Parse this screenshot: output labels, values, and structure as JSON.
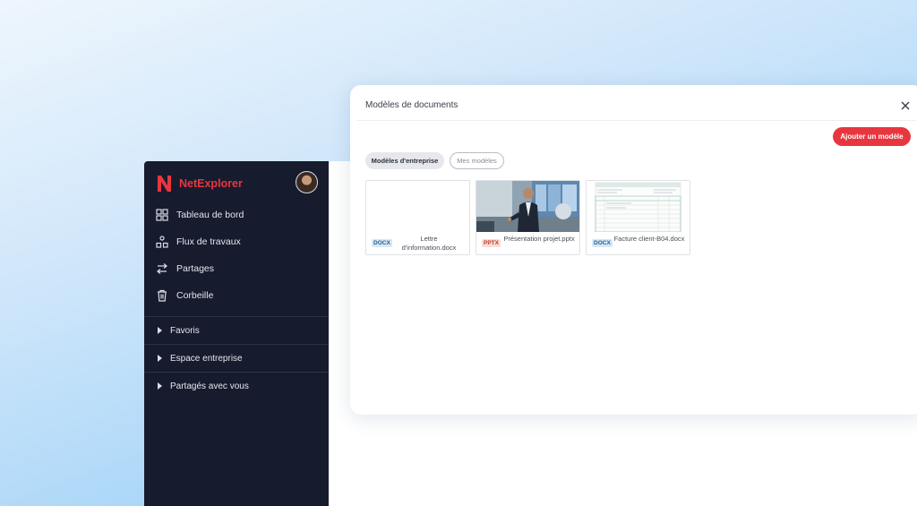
{
  "app": {
    "brand_name": "NetExplorer",
    "brand_color": "#e8363f",
    "sidebar_bg": "#171b2e"
  },
  "sidebar": {
    "items": [
      {
        "label": "Tableau de bord",
        "icon": "dashboard-icon"
      },
      {
        "label": "Flux de travaux",
        "icon": "workflow-icon"
      },
      {
        "label": "Partages",
        "icon": "share-arrows-icon"
      },
      {
        "label": "Corbeille",
        "icon": "trash-icon"
      }
    ],
    "sections": [
      {
        "label": "Favoris"
      },
      {
        "label": "Espace entreprise"
      },
      {
        "label": "Partagés avec vous"
      }
    ]
  },
  "modal": {
    "title": "Modèles de documents",
    "add_button": "Ajouter un modèle",
    "tabs": [
      {
        "label": "Modèles d'entreprise",
        "active": true
      },
      {
        "label": "Mes modèles",
        "active": false
      }
    ],
    "templates": [
      {
        "type": "DOCX",
        "name": "Lettre d'information.docx",
        "thumb": "blank"
      },
      {
        "type": "PPTX",
        "name": "Présentation projet.pptx",
        "thumb": "photo-presenter"
      },
      {
        "type": "DOCX",
        "name": "Facture client-B04.docx",
        "thumb": "invoice"
      }
    ]
  }
}
